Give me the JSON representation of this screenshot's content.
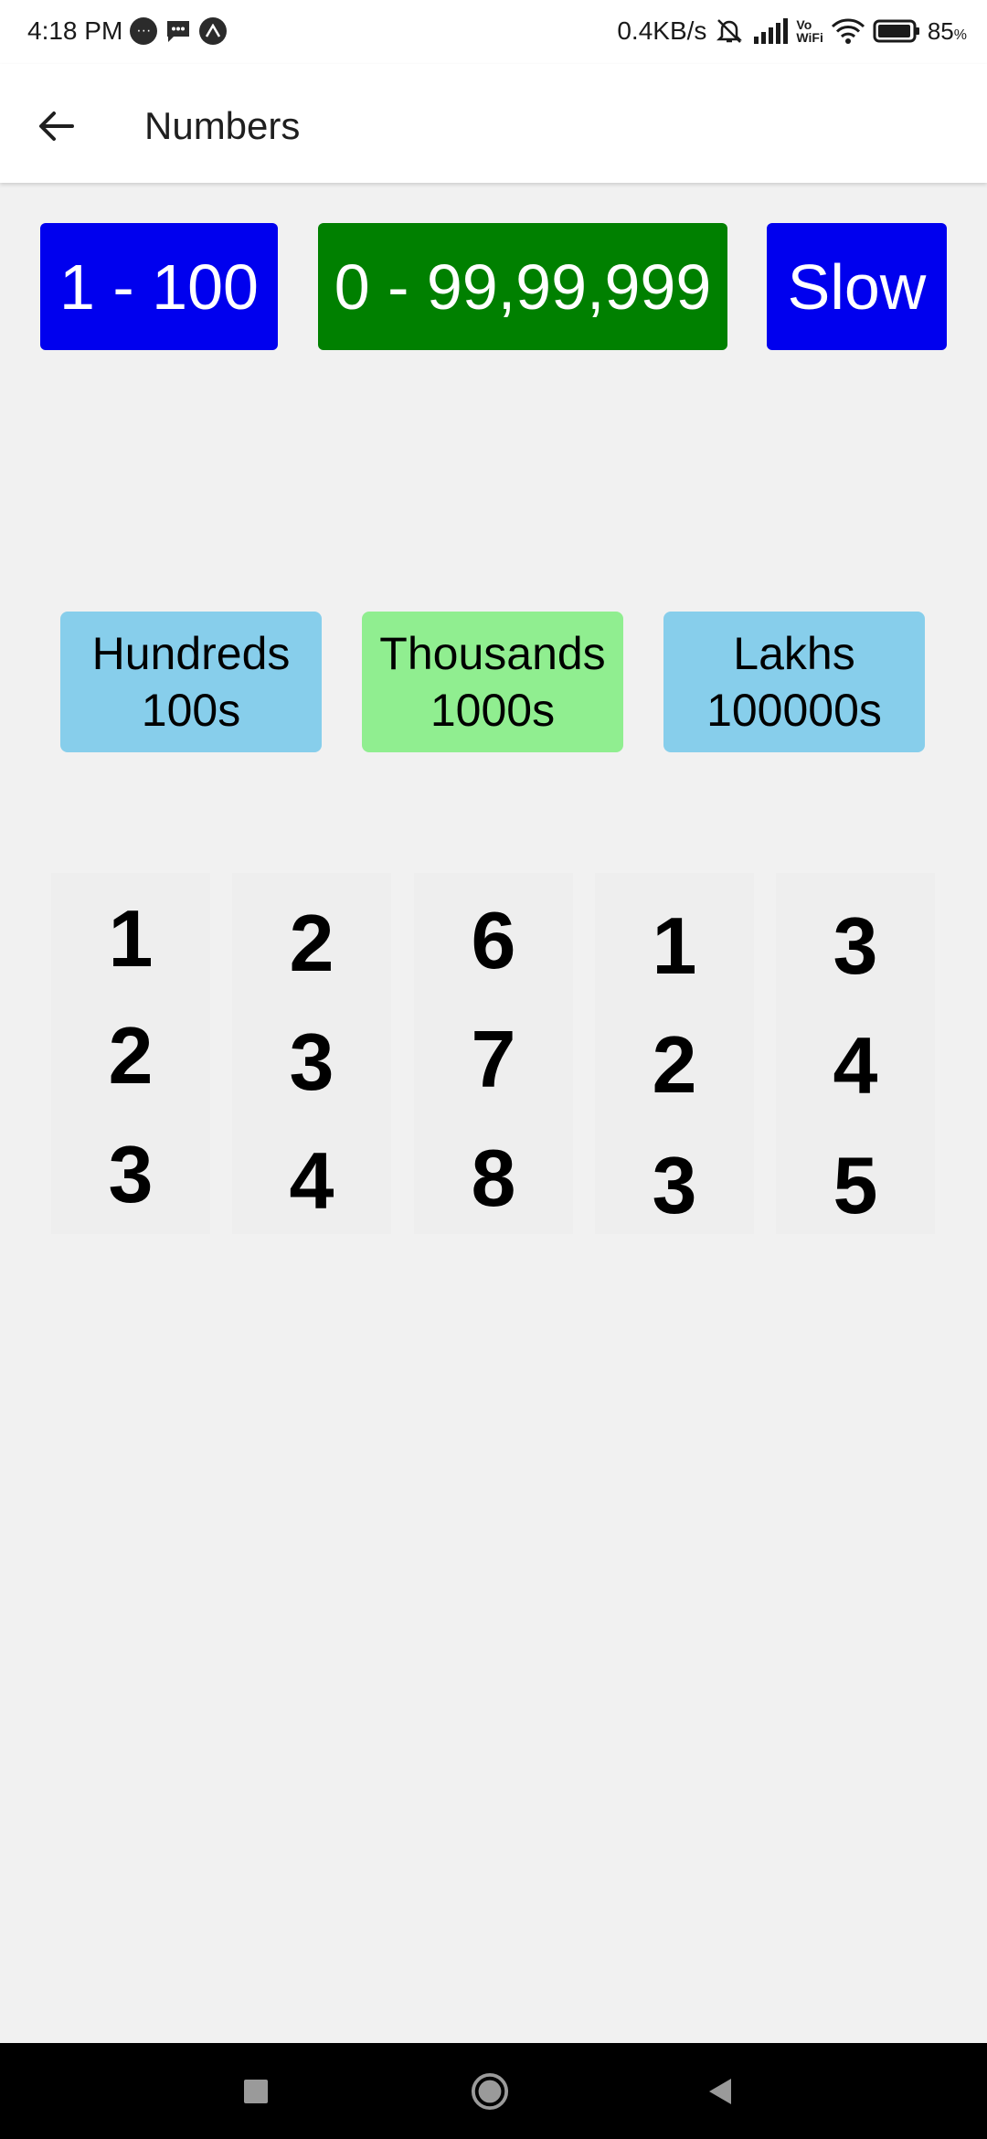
{
  "status_bar": {
    "time": "4:18 PM",
    "speed": "0.4KB/s",
    "vo_top": "Vo",
    "vo_bottom": "WiFi",
    "battery_percent": "85",
    "battery_unit": "%"
  },
  "app_bar": {
    "title": "Numbers"
  },
  "range_buttons": [
    {
      "label": "1 - 100",
      "color": "#0000ee"
    },
    {
      "label": "0 - 99,99,999",
      "color": "#008000"
    },
    {
      "label": "Slow",
      "color": "#0000ee"
    }
  ],
  "categories": [
    {
      "name": "Hundreds",
      "value": "100s",
      "color": "#87ceeb"
    },
    {
      "name": "Thousands",
      "value": "1000s",
      "color": "#90ee90"
    },
    {
      "name": "Lakhs",
      "value": "100000s",
      "color": "#87ceeb"
    }
  ],
  "number_columns": [
    [
      "1",
      "2",
      "3"
    ],
    [
      "2",
      "3",
      "4"
    ],
    [
      "6",
      "7",
      "8"
    ],
    [
      "1",
      "2",
      "3"
    ],
    [
      "3",
      "4",
      "5"
    ]
  ],
  "icons": {
    "back": "arrow-left-icon",
    "nav_recent": "square-icon",
    "nav_home": "circle-icon",
    "nav_back": "triangle-left-icon"
  }
}
